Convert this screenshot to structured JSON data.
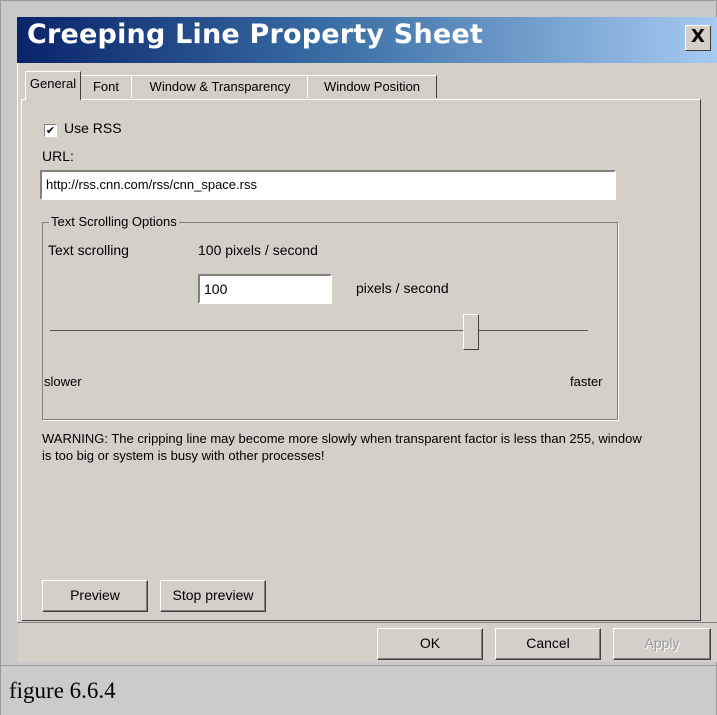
{
  "window": {
    "title": "Creeping Line Property Sheet",
    "close_glyph": "X"
  },
  "tabs": [
    {
      "label": "General",
      "active": true
    },
    {
      "label": "Font",
      "active": false
    },
    {
      "label": "Window & Transparency",
      "active": false
    },
    {
      "label": "Window Position",
      "active": false
    }
  ],
  "general": {
    "use_rss": {
      "label": "Use RSS",
      "checked": true,
      "check_glyph": "✔"
    },
    "url_label": "URL:",
    "url_value": "http://rss.cnn.com/rss/cnn_space.rss",
    "scrolling_group": {
      "title": "Text Scrolling Options",
      "row_label": "Text scrolling",
      "row_value": "100 pixels / second",
      "speed_value": "100",
      "speed_unit": "pixels / second",
      "slider": {
        "min_label": "slower",
        "max_label": "faster",
        "level": 0.78
      }
    },
    "warning": "WARNING: The cripping line may become more slowly when transparent factor is less than 255, window is too big or system is busy with other processes!",
    "preview_button": "Preview",
    "stop_preview_button": "Stop preview"
  },
  "footer_buttons": {
    "ok": "OK",
    "cancel": "Cancel",
    "apply": "Apply"
  },
  "caption": "figure 6.6.4",
  "colors": {
    "titlebar_start": "#0a246a",
    "titlebar_end": "#a6caf0",
    "dialog_face": "#d4d0c8"
  }
}
